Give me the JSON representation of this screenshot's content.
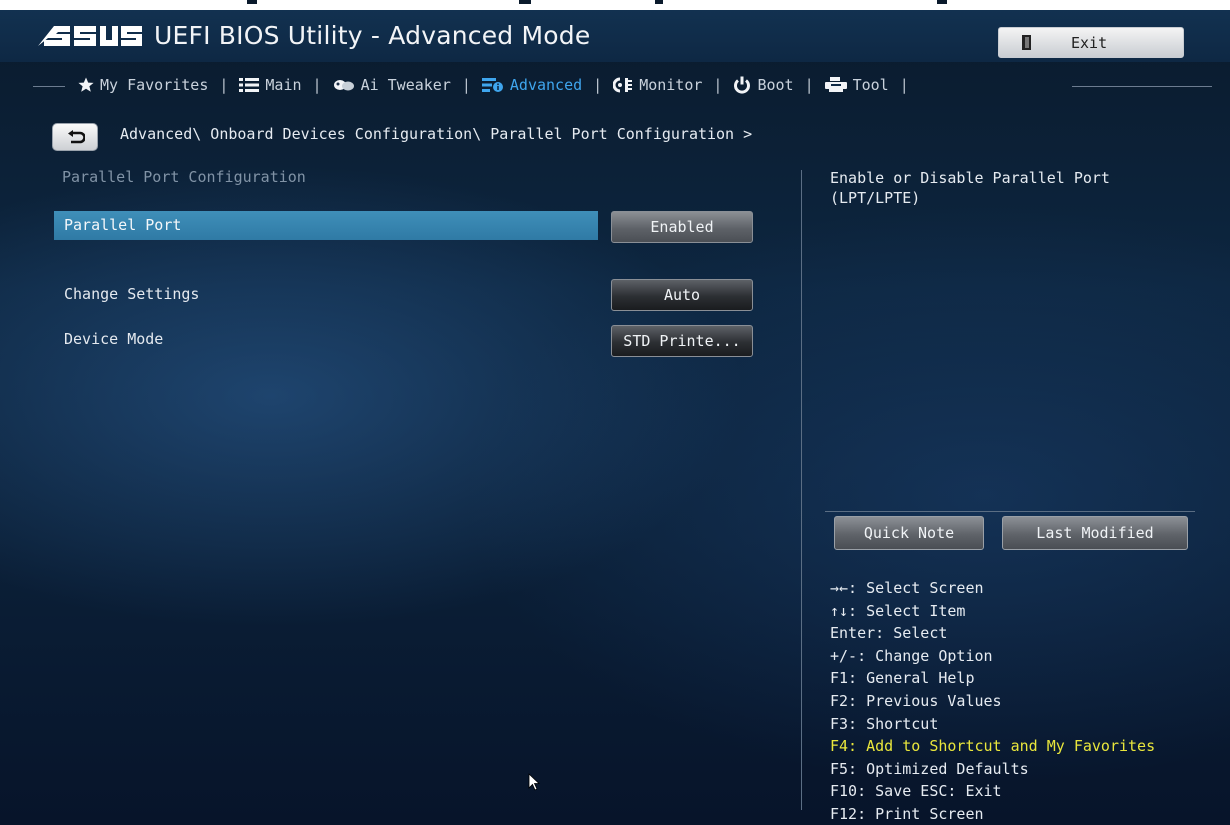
{
  "titlebar": {
    "title": "UEFI BIOS Utility - Advanced Mode",
    "exit_label": "Exit"
  },
  "menu": {
    "tabs": [
      {
        "label": "My Favorites",
        "icon": "star-icon",
        "active": false
      },
      {
        "label": "Main",
        "icon": "list-icon",
        "active": false
      },
      {
        "label": "Ai Tweaker",
        "icon": "tweaker-icon",
        "active": false
      },
      {
        "label": "Advanced",
        "icon": "advanced-icon",
        "active": true
      },
      {
        "label": "Monitor",
        "icon": "monitor-icon",
        "active": false
      },
      {
        "label": "Boot",
        "icon": "power-icon",
        "active": false
      },
      {
        "label": "Tool",
        "icon": "tool-icon",
        "active": false
      }
    ],
    "separator": "|"
  },
  "breadcrumb": "Advanced\\ Onboard Devices Configuration\\ Parallel Port Configuration >",
  "main": {
    "section_title": "Parallel Port Configuration",
    "rows": [
      {
        "label": "Parallel Port",
        "value": "Enabled",
        "selected": true
      },
      {
        "label": "Change Settings",
        "value": "Auto",
        "selected": false
      },
      {
        "label": "Device Mode",
        "value": "STD Printe...",
        "selected": false
      }
    ]
  },
  "help": {
    "line1": "Enable or Disable Parallel Port",
    "line2": "(LPT/LPTE)"
  },
  "side_buttons": {
    "quick_note": "Quick Note",
    "last_modified": "Last Modified"
  },
  "keys": [
    "→←: Select Screen",
    "↑↓: Select Item",
    "Enter: Select",
    "+/-: Change Option",
    "F1: General Help",
    "F2: Previous Values",
    "F3: Shortcut",
    "F4: Add to Shortcut and My Favorites",
    "F5: Optimized Defaults",
    "F10: Save  ESC: Exit",
    "F12: Print Screen"
  ],
  "colors": {
    "active_tab": "#3fa6ee",
    "selected_row": "#3486b1",
    "highlight_key": "#e9e63c"
  }
}
